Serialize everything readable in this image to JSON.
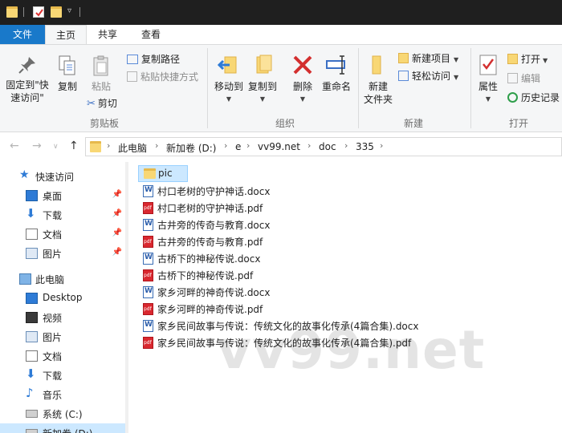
{
  "ribbon": {
    "tabs": [
      {
        "label": "文件"
      },
      {
        "label": "主页"
      },
      {
        "label": "共享"
      },
      {
        "label": "查看"
      }
    ],
    "clipboard": {
      "pin_label_1": "固定到\"快",
      "pin_label_2": "速访问\"",
      "copy_label": "复制",
      "paste_label": "粘贴",
      "copy_path_label": "复制路径",
      "paste_shortcut_label": "粘贴快捷方式",
      "cut_label": "剪切",
      "group_label": "剪贴板"
    },
    "organize": {
      "move_to_label": "移动到",
      "copy_to_label": "复制到",
      "delete_label": "删除",
      "rename_label": "重命名",
      "group_label": "组织"
    },
    "new": {
      "new_folder_label_1": "新建",
      "new_folder_label_2": "文件夹",
      "new_item_label": "新建项目",
      "easy_access_label": "轻松访问",
      "group_label": "新建"
    },
    "open": {
      "properties_label": "属性",
      "open_label": "打开",
      "edit_label": "编辑",
      "history_label": "历史记录",
      "group_label": "打开"
    }
  },
  "address": {
    "crumbs": [
      "此电脑",
      "新加卷 (D:)",
      "e",
      "vv99.net",
      "doc",
      "335"
    ]
  },
  "navpane": {
    "items": [
      {
        "label": "快速访问",
        "icon": "star-icon"
      },
      {
        "label": "桌面",
        "icon": "desktop-icon"
      },
      {
        "label": "下载",
        "icon": "download-icon"
      },
      {
        "label": "文档",
        "icon": "documents-icon"
      },
      {
        "label": "图片",
        "icon": "pictures-icon"
      },
      {
        "label": "此电脑",
        "icon": "computer-icon"
      },
      {
        "label": "Desktop",
        "icon": "desktop-icon"
      },
      {
        "label": "视频",
        "icon": "video-icon"
      },
      {
        "label": "图片",
        "icon": "pictures-icon"
      },
      {
        "label": "文档",
        "icon": "documents-icon"
      },
      {
        "label": "下载",
        "icon": "download-icon"
      },
      {
        "label": "音乐",
        "icon": "music-icon"
      },
      {
        "label": "系统 (C:)",
        "icon": "drive-icon"
      },
      {
        "label": "新加卷 (D:)",
        "icon": "drive-icon"
      }
    ]
  },
  "files": [
    {
      "name": "pic",
      "type": "folder"
    },
    {
      "name": "村口老树的守护神话.docx",
      "type": "docx"
    },
    {
      "name": "村口老树的守护神话.pdf",
      "type": "pdf"
    },
    {
      "name": "古井旁的传奇与教育.docx",
      "type": "docx"
    },
    {
      "name": "古井旁的传奇与教育.pdf",
      "type": "pdf"
    },
    {
      "name": "古桥下的神秘传说.docx",
      "type": "docx"
    },
    {
      "name": "古桥下的神秘传说.pdf",
      "type": "pdf"
    },
    {
      "name": "家乡河畔的神奇传说.docx",
      "type": "docx"
    },
    {
      "name": "家乡河畔的神奇传说.pdf",
      "type": "pdf"
    },
    {
      "name": "家乡民间故事与传说：传统文化的故事化传承(4篇合集).docx",
      "type": "docx"
    },
    {
      "name": "家乡民间故事与传说：传统文化的故事化传承(4篇合集).pdf",
      "type": "pdf"
    }
  ],
  "watermark": "vv99.net",
  "colors": {
    "accent": "#1979ca",
    "selection": "#cce8ff",
    "titlebar": "#1f1f1f",
    "ribbon_bg": "#f5f6f7"
  }
}
